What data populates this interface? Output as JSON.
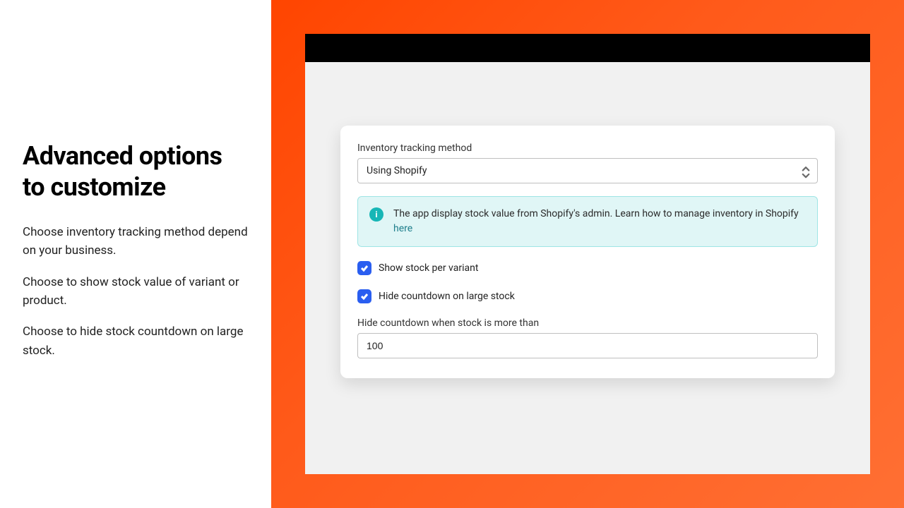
{
  "left": {
    "heading": "Advanced options to customize",
    "paragraphs": [
      "Choose inventory tracking method depend on your business.",
      "Choose to show stock value of variant or product.",
      "Choose to hide stock countdown on large stock."
    ]
  },
  "form": {
    "tracking_method_label": "Inventory tracking method",
    "tracking_method_value": "Using Shopify",
    "banner_text": "The app display stock value from Shopify's admin. Learn how to manage inventory in Shopify ",
    "banner_link_text": "here",
    "show_stock_per_variant_label": "Show stock per variant",
    "show_stock_per_variant_checked": true,
    "hide_countdown_large_stock_label": "Hide countdown on large stock",
    "hide_countdown_large_stock_checked": true,
    "threshold_label": "Hide countdown when stock is more than",
    "threshold_value": "100"
  },
  "icons": {
    "info": "i"
  }
}
